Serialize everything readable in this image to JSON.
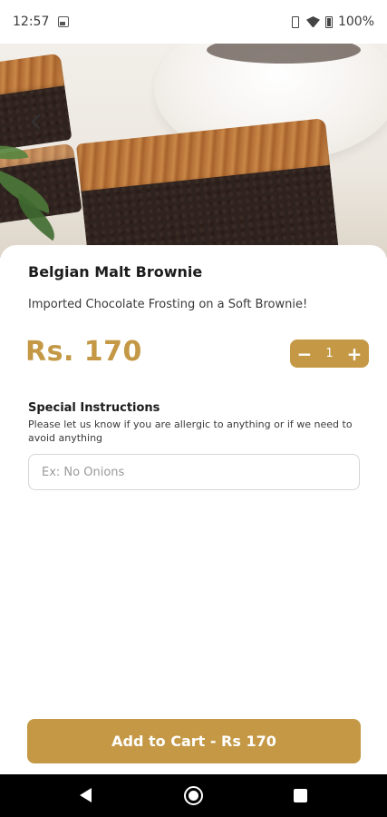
{
  "status_bar": {
    "time": "12:57",
    "battery_pct": "100%",
    "icons": [
      "image-icon",
      "vibrate-icon",
      "wifi-icon",
      "battery-icon"
    ]
  },
  "hero": {
    "image_subject": "brownie-photo",
    "back_icon": "back-arrow-icon"
  },
  "product": {
    "name": "Belgian Malt Brownie",
    "description": "Imported Chocolate Frosting on a Soft Brownie!",
    "price": "Rs. 170"
  },
  "quantity": {
    "minus": "−",
    "value": "1",
    "plus": "+"
  },
  "special_instructions": {
    "title": "Special Instructions",
    "description": "Please let us know if you are allergic to anything or if we need to avoid anything",
    "placeholder": "Ex: No Onions",
    "value": ""
  },
  "cart_button": {
    "label": "Add to Cart - Rs 170"
  },
  "nav_bar": {
    "icons": [
      "back-icon",
      "home-icon",
      "recents-icon"
    ]
  },
  "colors": {
    "accent": "#c49845",
    "text": "#1c1c1c",
    "nav_bg": "#000000"
  }
}
